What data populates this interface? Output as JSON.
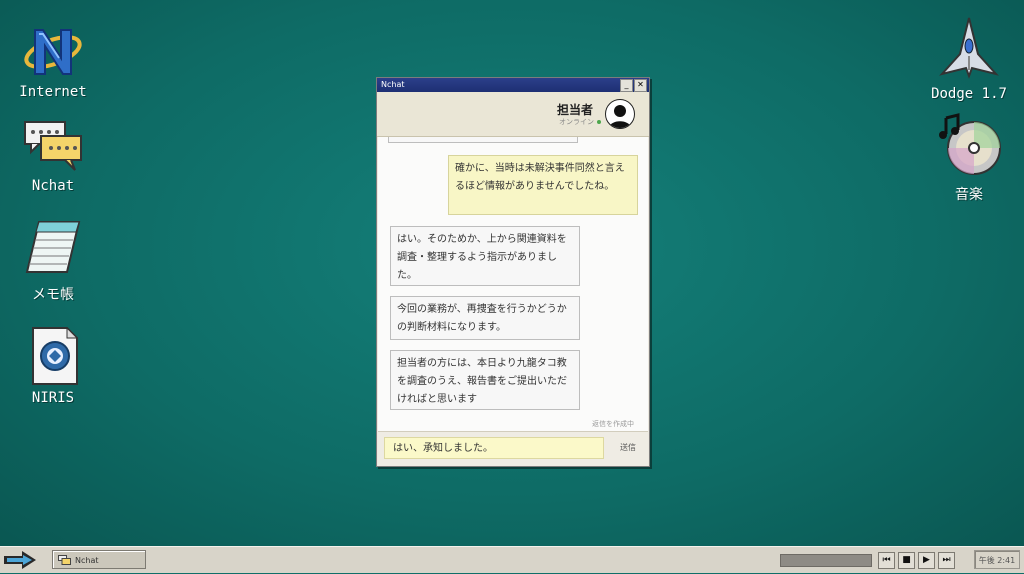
{
  "desktop": {
    "icons_left": [
      {
        "label": "Internet",
        "icon": "internet-icon"
      },
      {
        "label": "Nchat",
        "icon": "chat-icon"
      },
      {
        "label": "メモ帳",
        "icon": "notepad-icon"
      },
      {
        "label": "NIRIS",
        "icon": "document-emblem-icon"
      }
    ],
    "icons_right": [
      {
        "label": "Dodge 1.7",
        "icon": "spaceship-icon"
      },
      {
        "label": "音楽",
        "icon": "music-cd-icon"
      }
    ]
  },
  "window": {
    "title": "Nchat",
    "min_symbol": "_",
    "close_symbol": "✕",
    "contact_name": "担当者",
    "contact_status": "オンライン",
    "messages": [
      {
        "from": "me",
        "text": "確かに、当時は未解決事件同然と言えるほど情報がありませんでしたね。"
      },
      {
        "from": "them",
        "text": "はい。そのためか、上から関連資料を調査・整理するよう指示がありました。"
      },
      {
        "from": "them",
        "text": "今回の業務が、再捜査を行うかどうかの判断材料になります。"
      },
      {
        "from": "them",
        "text": "担当者の方には、本日より九龍タコ教を調査のうえ、報告書をご提出いただければと思います"
      }
    ],
    "typing_indicator": "返信を作成中",
    "input_value": "はい、承知しました。",
    "send_label": "送信"
  },
  "taskbar": {
    "task_label": "Nchat",
    "media_controls": [
      "⏮",
      "■",
      "▶",
      "⏭"
    ],
    "clock": "午後 2:41"
  },
  "colors": {
    "desktop": "#0f6e68",
    "titlebar": "#1e2f73",
    "my_bubble": "#f8f6c6"
  }
}
